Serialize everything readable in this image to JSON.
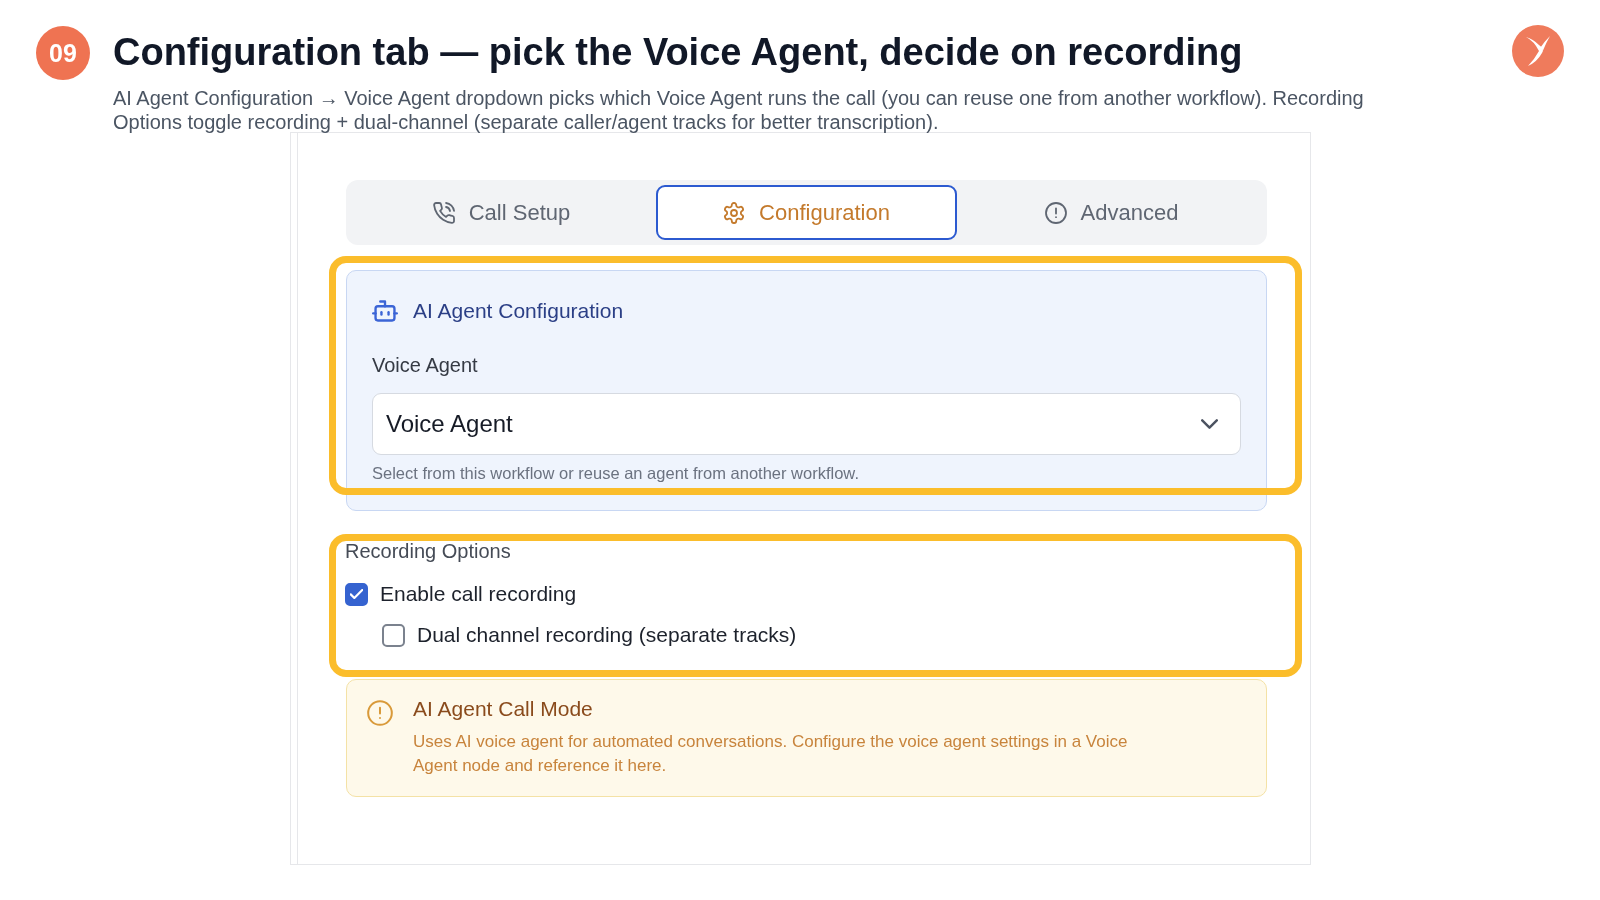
{
  "step": {
    "number": "09",
    "title": "Configuration tab — pick the Voice Agent, decide on recording",
    "description": "AI Agent Configuration → Voice Agent dropdown picks which Voice Agent runs the call (you can reuse one from another workflow). Recording Options toggle recording + dual-channel (separate caller/agent tracks for better transcription)."
  },
  "tabs": [
    {
      "label": "Call Setup",
      "selected": false
    },
    {
      "label": "Configuration",
      "selected": true
    },
    {
      "label": "Advanced",
      "selected": false
    }
  ],
  "ai_agent_config": {
    "title": "AI Agent Configuration",
    "highlighted": true,
    "voice_agent": {
      "label": "Voice Agent",
      "value": "Voice Agent",
      "hint": "Select from this workflow or reuse an agent from another workflow."
    }
  },
  "recording_options": {
    "title": "Recording Options",
    "highlighted": true,
    "options": [
      {
        "label": "Enable call recording",
        "checked": true,
        "children": [
          {
            "label": "Dual channel recording (separate tracks)",
            "checked": false
          }
        ]
      }
    ]
  },
  "call_mode_notice": {
    "title": "AI Agent Call Mode",
    "text": "Uses AI voice agent for automated conversations. Configure the voice agent settings in a Voice Agent node and reference it here."
  }
}
